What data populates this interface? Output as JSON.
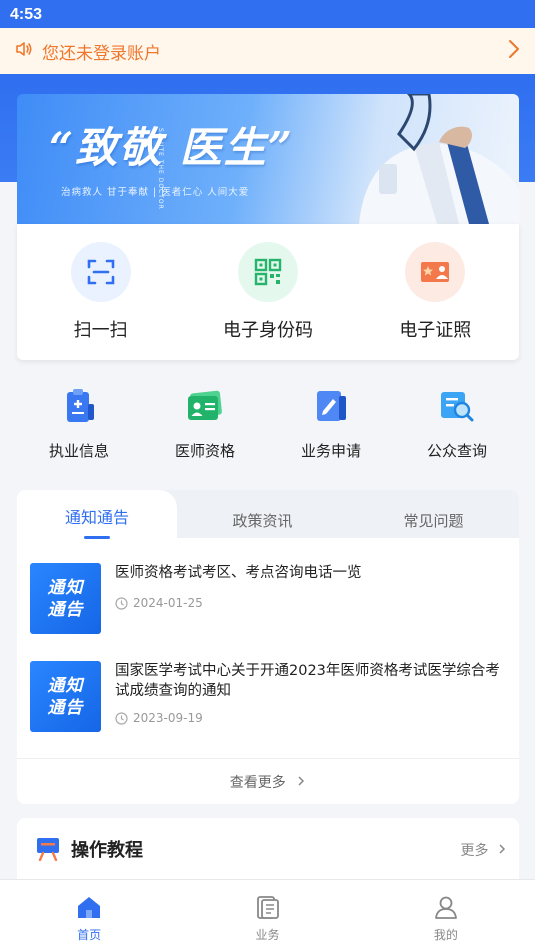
{
  "status_bar": {
    "time": "4:53"
  },
  "notice": {
    "text": "您还未登录账户",
    "icon": "speaker-icon"
  },
  "banner": {
    "title": "“致敬 医生”",
    "vertical_text": "SALUTE THE DOCTOR",
    "subtitle": "治病救人  甘于奉献  |  医者仁心  人间大爱"
  },
  "quick_actions": [
    {
      "label": "扫一扫",
      "icon": "scan-icon"
    },
    {
      "label": "电子身份码",
      "icon": "qr-code-icon"
    },
    {
      "label": "电子证照",
      "icon": "id-card-icon"
    }
  ],
  "functions": [
    {
      "label": "执业信息",
      "icon": "practice-info-icon"
    },
    {
      "label": "医师资格",
      "icon": "doctor-qualification-icon"
    },
    {
      "label": "业务申请",
      "icon": "business-apply-icon"
    },
    {
      "label": "公众查询",
      "icon": "public-search-icon"
    }
  ],
  "news": {
    "tabs": [
      "通知通告",
      "政策资讯",
      "常见问题"
    ],
    "active_tab": 0,
    "thumb_text_1": "通知",
    "thumb_text_2": "通告",
    "items": [
      {
        "title": "医师资格考试考区、考点咨询电话一览",
        "date": "2024-01-25"
      },
      {
        "title": "国家医学考试中心关于开通2023年医师资格考试医学综合考试成绩查询的通知",
        "date": "2023-09-19"
      }
    ],
    "more_label": "查看更多"
  },
  "tutorial": {
    "title": "操作教程",
    "more_label": "更多"
  },
  "tab_bar": [
    {
      "label": "首页",
      "icon": "home-icon",
      "active": true
    },
    {
      "label": "业务",
      "icon": "business-icon",
      "active": false
    },
    {
      "label": "我的",
      "icon": "profile-icon",
      "active": false
    }
  ],
  "colors": {
    "primary": "#2f6ff0",
    "notice_text": "#f0762c",
    "notice_bg": "#fff7ec"
  }
}
